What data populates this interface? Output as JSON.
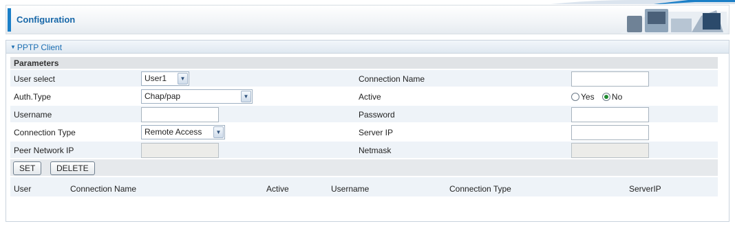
{
  "header": {
    "title": "Configuration"
  },
  "panel": {
    "title": "PPTP Client"
  },
  "form": {
    "section_label": "Parameters",
    "user_select": {
      "label": "User select",
      "value": "User1"
    },
    "connection_name": {
      "label": "Connection Name",
      "value": ""
    },
    "auth_type": {
      "label": "Auth.Type",
      "value": "Chap/pap"
    },
    "active": {
      "label": "Active",
      "options": [
        "Yes",
        "No"
      ],
      "selected": "No"
    },
    "username": {
      "label": "Username",
      "value": ""
    },
    "password": {
      "label": "Password",
      "value": ""
    },
    "connection_type": {
      "label": "Connection Type",
      "value": "Remote Access"
    },
    "server_ip": {
      "label": "Server IP",
      "value": ""
    },
    "peer_network_ip": {
      "label": "Peer Network IP",
      "value": ""
    },
    "netmask": {
      "label": "Netmask",
      "value": ""
    }
  },
  "buttons": {
    "set": "SET",
    "delete": "DELETE"
  },
  "table": {
    "columns": [
      "User",
      "Connection Name",
      "Active",
      "Username",
      "Connection Type",
      "ServerIP"
    ]
  },
  "colors": {
    "accent": "#1b7fc7",
    "title": "#1767a8",
    "link": "#1b6eb2"
  }
}
